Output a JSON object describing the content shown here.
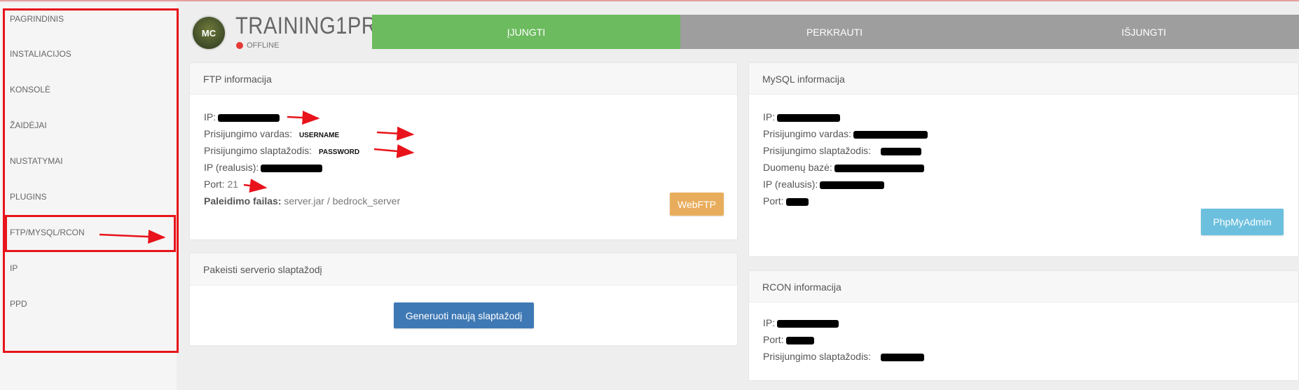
{
  "sidebar": {
    "items": [
      {
        "label": "PAGRINDINIS"
      },
      {
        "label": "INSTALIACIJOS"
      },
      {
        "label": "KONSOLĖ"
      },
      {
        "label": "ŽAIDĖJAI"
      },
      {
        "label": "NUSTATYMAI"
      },
      {
        "label": "PLUGINS"
      },
      {
        "label": "FTP/MYSQL/RCON"
      },
      {
        "label": "IP"
      },
      {
        "label": "PPD"
      }
    ]
  },
  "header": {
    "avatar_initials": "MC",
    "server_name": "TRAINING1PRO",
    "status": "OFFLINE",
    "status_color": "#e53935"
  },
  "power_buttons": {
    "start": "ĮJUNGTI",
    "restart": "PERKRAUTI",
    "stop": "IŠJUNGTI",
    "start_color": "#6cbb5f",
    "other_color": "#9e9e9e"
  },
  "ftp": {
    "title": "FTP informacija",
    "ip_label": "IP:",
    "username_label": "Prisijungimo vardas:",
    "username_value": "USERNAME",
    "password_label": "Prisijungimo slaptažodis:",
    "password_value": "PASSWORD",
    "real_ip_label": "IP (realusis):",
    "port_label": "Port:",
    "port_value": "21",
    "startup_label": "Paleidimo failas:",
    "startup_value": "server.jar / bedrock_server",
    "webftp_button": "WebFTP"
  },
  "change_password": {
    "title": "Pakeisti serverio slaptažodį",
    "generate_button": "Generuoti naują slaptažodį"
  },
  "mysql": {
    "title": "MySQL informacija",
    "ip_label": "IP:",
    "username_label": "Prisijungimo vardas:",
    "password_label": "Prisijungimo slaptažodis:",
    "database_label": "Duomenų bazė:",
    "real_ip_label": "IP (realusis):",
    "port_label": "Port:",
    "phpmyadmin_button": "PhpMyAdmin"
  },
  "rcon": {
    "title": "RCON informacija",
    "ip_label": "IP:",
    "port_label": "Port:",
    "password_label": "Prisijungimo slaptažodis:"
  },
  "colors": {
    "highlight_red": "#e8131b",
    "webftp": "#e8ad5c",
    "generate": "#3f79b5",
    "phpmyadmin": "#6cc0de"
  }
}
